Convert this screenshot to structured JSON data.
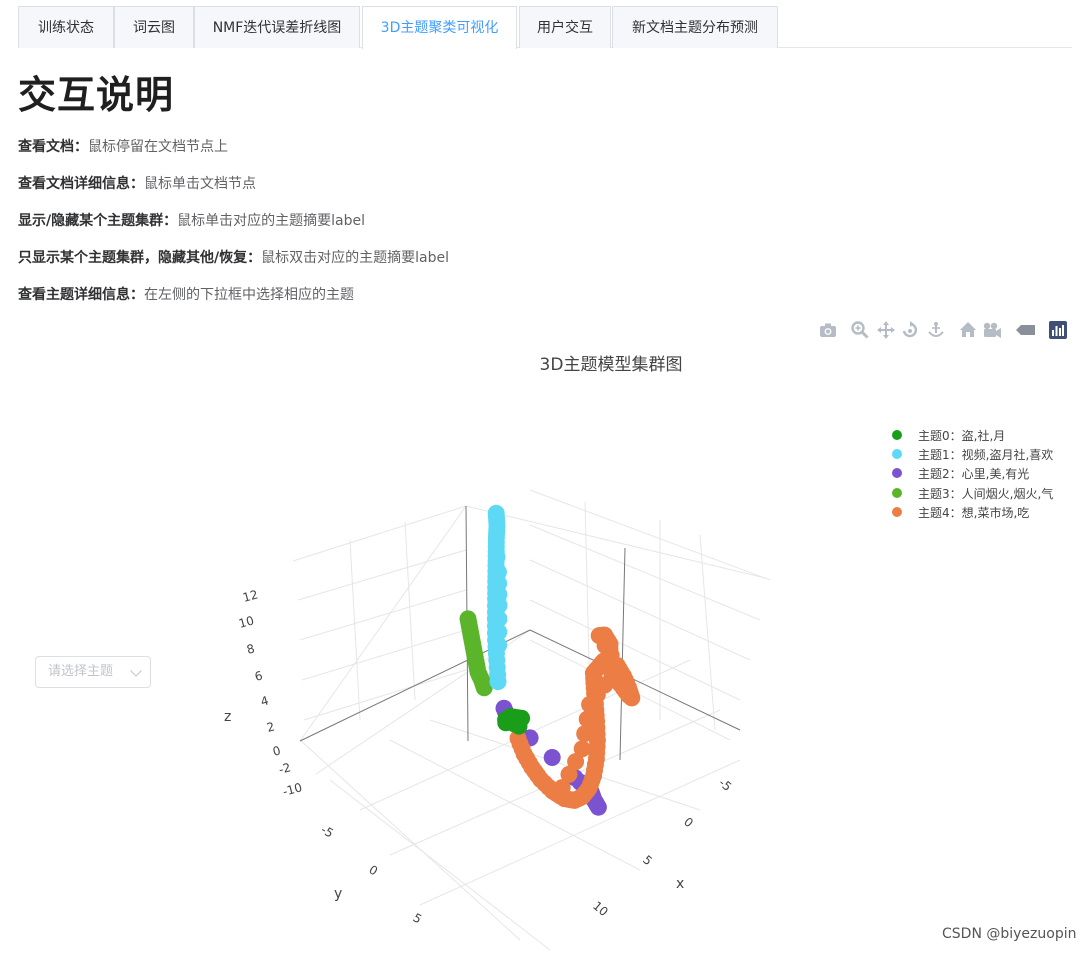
{
  "tabs": [
    {
      "label": "训练状态",
      "active": false
    },
    {
      "label": "词云图",
      "active": false
    },
    {
      "label": "NMF迭代误差折线图",
      "active": false
    },
    {
      "label": "3D主题聚类可视化",
      "active": true
    },
    {
      "label": "用户交互",
      "active": false
    },
    {
      "label": "新文档主题分布预测",
      "active": false
    }
  ],
  "instructions": {
    "title": "交互说明",
    "items": [
      {
        "label": "查看文档：",
        "text": "鼠标停留在文档节点上"
      },
      {
        "label": "查看文档详细信息：",
        "text": "鼠标单击文档节点"
      },
      {
        "label": "显示/隐藏某个主题集群：",
        "text": "鼠标单击对应的主题摘要label"
      },
      {
        "label": "只显示某个主题集群，隐藏其他/恢复：",
        "text": "鼠标双击对应的主题摘要label"
      },
      {
        "label": "查看主题详细信息：",
        "text": "在左侧的下拉框中选择相应的主题"
      }
    ]
  },
  "topic_select": {
    "placeholder": "请选择主题"
  },
  "modebar": {
    "icons": [
      "camera-icon",
      "zoom-icon",
      "pan-icon",
      "orbit-rotation-icon",
      "turntable-rotation-icon",
      "reset-camera-icon",
      "last-save-camera-icon",
      "hover-toggle-icon",
      "plotly-logo-icon"
    ]
  },
  "watermark": "CSDN @biyezuopin",
  "colors": {
    "topic0": "#1a9e1a",
    "topic1": "#5dd8f5",
    "topic2": "#7b52cf",
    "topic3": "#5bb52a",
    "topic4": "#ec7d45",
    "active_tab": "#409eff"
  },
  "chart_data": {
    "type": "scatter3d",
    "title": "3D主题模型集群图",
    "axes": {
      "x": {
        "label": "x",
        "ticks": [
          "-5",
          "0",
          "5",
          "10"
        ],
        "range": [
          -7,
          12
        ]
      },
      "y": {
        "label": "y",
        "ticks": [
          "-5",
          "0",
          "5"
        ],
        "range": [
          -7,
          7
        ]
      },
      "z": {
        "label": "z",
        "ticks": [
          "-10",
          "-2",
          "0",
          "2",
          "4",
          "6",
          "8",
          "10",
          "12"
        ],
        "range": [
          -10,
          13
        ]
      }
    },
    "legend_position": "top-right",
    "series": [
      {
        "name": "主题0：盗,社,月",
        "color": "#1a9e1a",
        "points": [
          [
            -1.0,
            0.0,
            1.0
          ],
          [
            -1.4,
            -0.2,
            0.7
          ],
          [
            -1.8,
            -0.1,
            0.4
          ],
          [
            -1.2,
            0.3,
            1.3
          ],
          [
            -0.6,
            0.0,
            1.1
          ],
          [
            -1.6,
            0.2,
            0.9
          ],
          [
            -1.0,
            -0.3,
            0.2
          ]
        ]
      },
      {
        "name": "主题1：视频,盗月社,喜欢",
        "color": "#5dd8f5",
        "points": [
          [
            -3.0,
            -1.0,
            2.5
          ],
          [
            -3.3,
            -1.3,
            3.8
          ],
          [
            -3.6,
            -1.6,
            5.0
          ],
          [
            -3.9,
            -2.0,
            6.2
          ],
          [
            -4.1,
            -2.3,
            7.4
          ],
          [
            -4.3,
            -2.6,
            8.4
          ],
          [
            -4.5,
            -2.9,
            9.3
          ],
          [
            -4.7,
            -3.2,
            10.1
          ],
          [
            -4.9,
            -3.5,
            10.9
          ],
          [
            -5.0,
            -3.7,
            11.6
          ],
          [
            -5.2,
            -3.9,
            12.3
          ],
          [
            -3.6,
            -1.9,
            4.4
          ],
          [
            -4.0,
            -2.5,
            6.8
          ],
          [
            -4.4,
            -3.0,
            8.8
          ]
        ]
      },
      {
        "name": "主题2：心里,美,有光",
        "color": "#7b52cf",
        "points": [
          [
            -1.5,
            0.5,
            2.0
          ],
          [
            -1.0,
            0.8,
            1.6
          ],
          [
            0.0,
            -4.5,
            -6.5
          ],
          [
            1.5,
            -4.0,
            -6.8
          ],
          [
            2.0,
            -3.6,
            -7.0
          ],
          [
            2.6,
            -3.2,
            -7.1
          ]
        ]
      },
      {
        "name": "主题3：人间烟火,烟火,气",
        "color": "#5bb52a",
        "points": [
          [
            -8.0,
            -5.0,
            3.0
          ],
          [
            -7.5,
            -4.5,
            2.7
          ],
          [
            -7.0,
            -4.0,
            2.4
          ],
          [
            -6.5,
            -3.5,
            2.1
          ],
          [
            -6.0,
            -3.0,
            1.8
          ],
          [
            -5.5,
            -2.5,
            1.5
          ],
          [
            -5.0,
            -2.2,
            1.2
          ],
          [
            -4.7,
            -2.0,
            0.9
          ]
        ]
      },
      {
        "name": "主题4：想,菜市场,吃",
        "color": "#ec7d45",
        "points": [
          [
            -0.5,
            0.5,
            0.0
          ],
          [
            0.3,
            1.0,
            -0.6
          ],
          [
            1.2,
            1.5,
            -1.0
          ],
          [
            2.2,
            2.0,
            -1.3
          ],
          [
            3.4,
            2.5,
            -1.5
          ],
          [
            4.6,
            3.0,
            -1.4
          ],
          [
            5.6,
            3.4,
            -1.0
          ],
          [
            6.4,
            3.7,
            -0.3
          ],
          [
            7.0,
            3.9,
            0.6
          ],
          [
            7.4,
            4.0,
            1.7
          ],
          [
            7.6,
            4.0,
            3.0
          ],
          [
            7.6,
            3.9,
            4.3
          ],
          [
            7.4,
            3.7,
            5.5
          ],
          [
            7.1,
            3.4,
            6.5
          ],
          [
            6.8,
            3.1,
            7.4
          ],
          [
            6.6,
            2.9,
            8.3
          ],
          [
            7.1,
            3.0,
            9.0
          ],
          [
            7.6,
            3.3,
            9.7
          ],
          [
            8.2,
            3.5,
            10.3
          ],
          [
            8.0,
            3.2,
            11.0
          ],
          [
            7.4,
            2.9,
            11.3
          ],
          [
            6.8,
            2.6,
            10.9
          ],
          [
            8.8,
            3.6,
            9.9
          ],
          [
            9.4,
            3.8,
            9.4
          ],
          [
            9.9,
            4.0,
            8.8
          ],
          [
            10.2,
            4.1,
            8.2
          ],
          [
            9.6,
            3.6,
            7.9
          ],
          [
            8.8,
            3.3,
            8.3
          ],
          [
            8.3,
            3.4,
            8.9
          ],
          [
            6.4,
            3.0,
            6.0
          ],
          [
            5.8,
            2.9,
            2.5
          ],
          [
            4.3,
            2.8,
            -0.8
          ]
        ]
      }
    ]
  }
}
